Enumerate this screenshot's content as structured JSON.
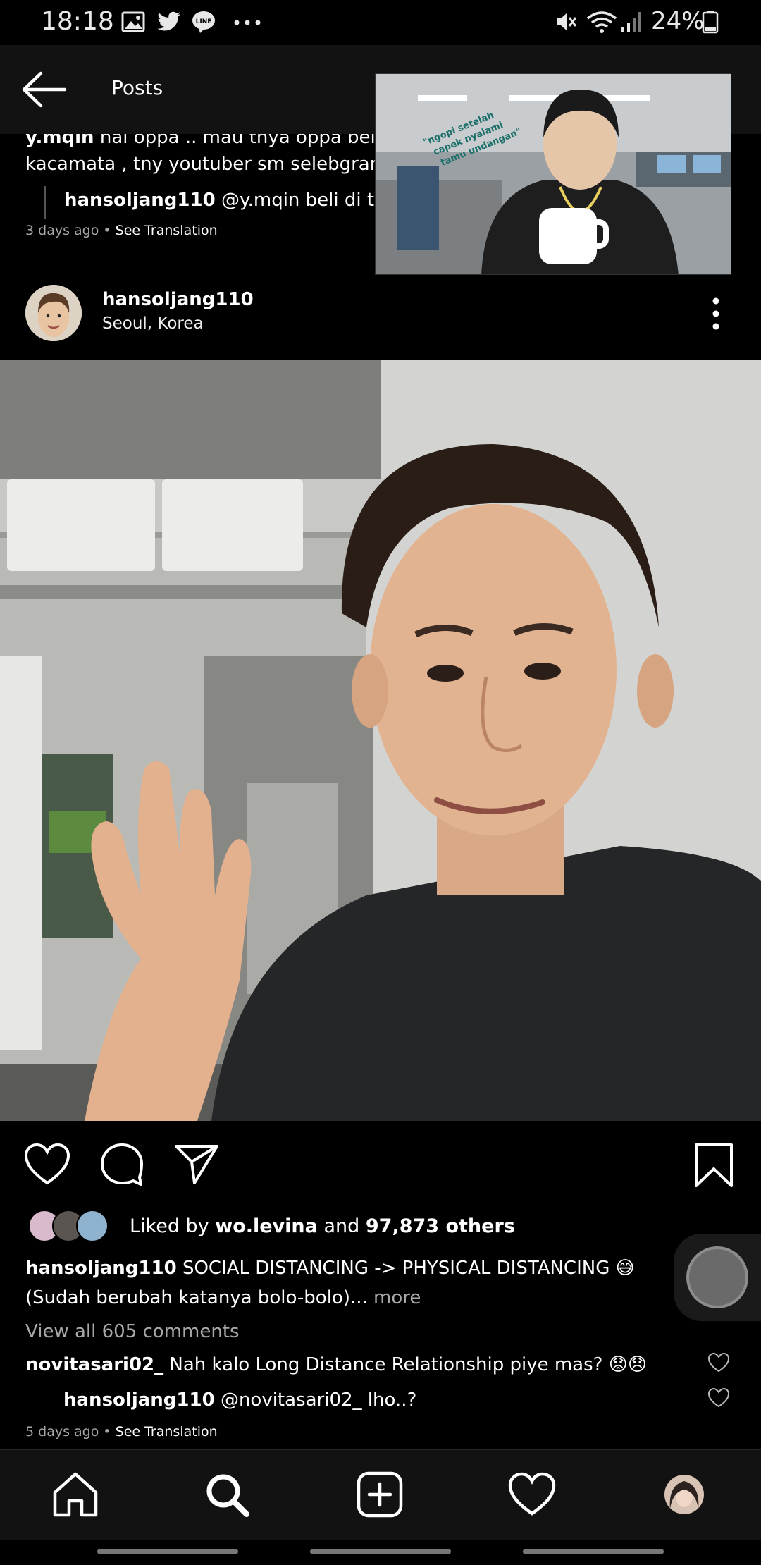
{
  "status_bar": {
    "time": "18:18",
    "battery": "24%",
    "icons": [
      "gallery-icon",
      "twitter-icon",
      "line-icon",
      "more-icon",
      "mute-icon",
      "wifi-icon",
      "signal-icon",
      "battery-icon"
    ]
  },
  "header": {
    "title": "Posts"
  },
  "previous_post": {
    "comment_user": "y.mqin",
    "comment_text": "hai oppa .. mau tnya oppa beli ka",
    "comment_text_2": "kacamata , tny youtuber sm selebgram",
    "reply_user": "hansoljang110",
    "reply_text": "@y.mqin beli di toko",
    "time_ago": "3 days ago",
    "see_translation": "See Translation"
  },
  "pip_video": {
    "overlay_text_1": "\"ngopi setelah",
    "overlay_text_2": "capek nyalami",
    "overlay_text_3": "tamu undangan\""
  },
  "post": {
    "username": "hansoljang110",
    "location": "Seoul, Korea",
    "likes_prefix": "Liked by",
    "liked_by": "wo.levina",
    "likes_mid": "and",
    "likes_count": "97,873 others",
    "caption_user": "hansoljang110",
    "caption_text": "SOCIAL DISTANCING -> PHYSICAL DISTANCING 😅",
    "caption_text_2": "(Sudah berubah katanya bolo-bolo)...",
    "more": "more",
    "view_all": "View all 605 comments",
    "comment1_user": "novitasari02_",
    "comment1_text": "Nah kalo Long Distance Relationship piye mas? 😟😞",
    "comment2_user": "hansoljang110",
    "comment2_text": "@novitasari02_ lho..?",
    "time_ago": "5 days ago",
    "see_translation": "See Translation"
  },
  "colors": {
    "background": "#000000",
    "header": "#121212",
    "muted_text": "#a8a8a8"
  }
}
